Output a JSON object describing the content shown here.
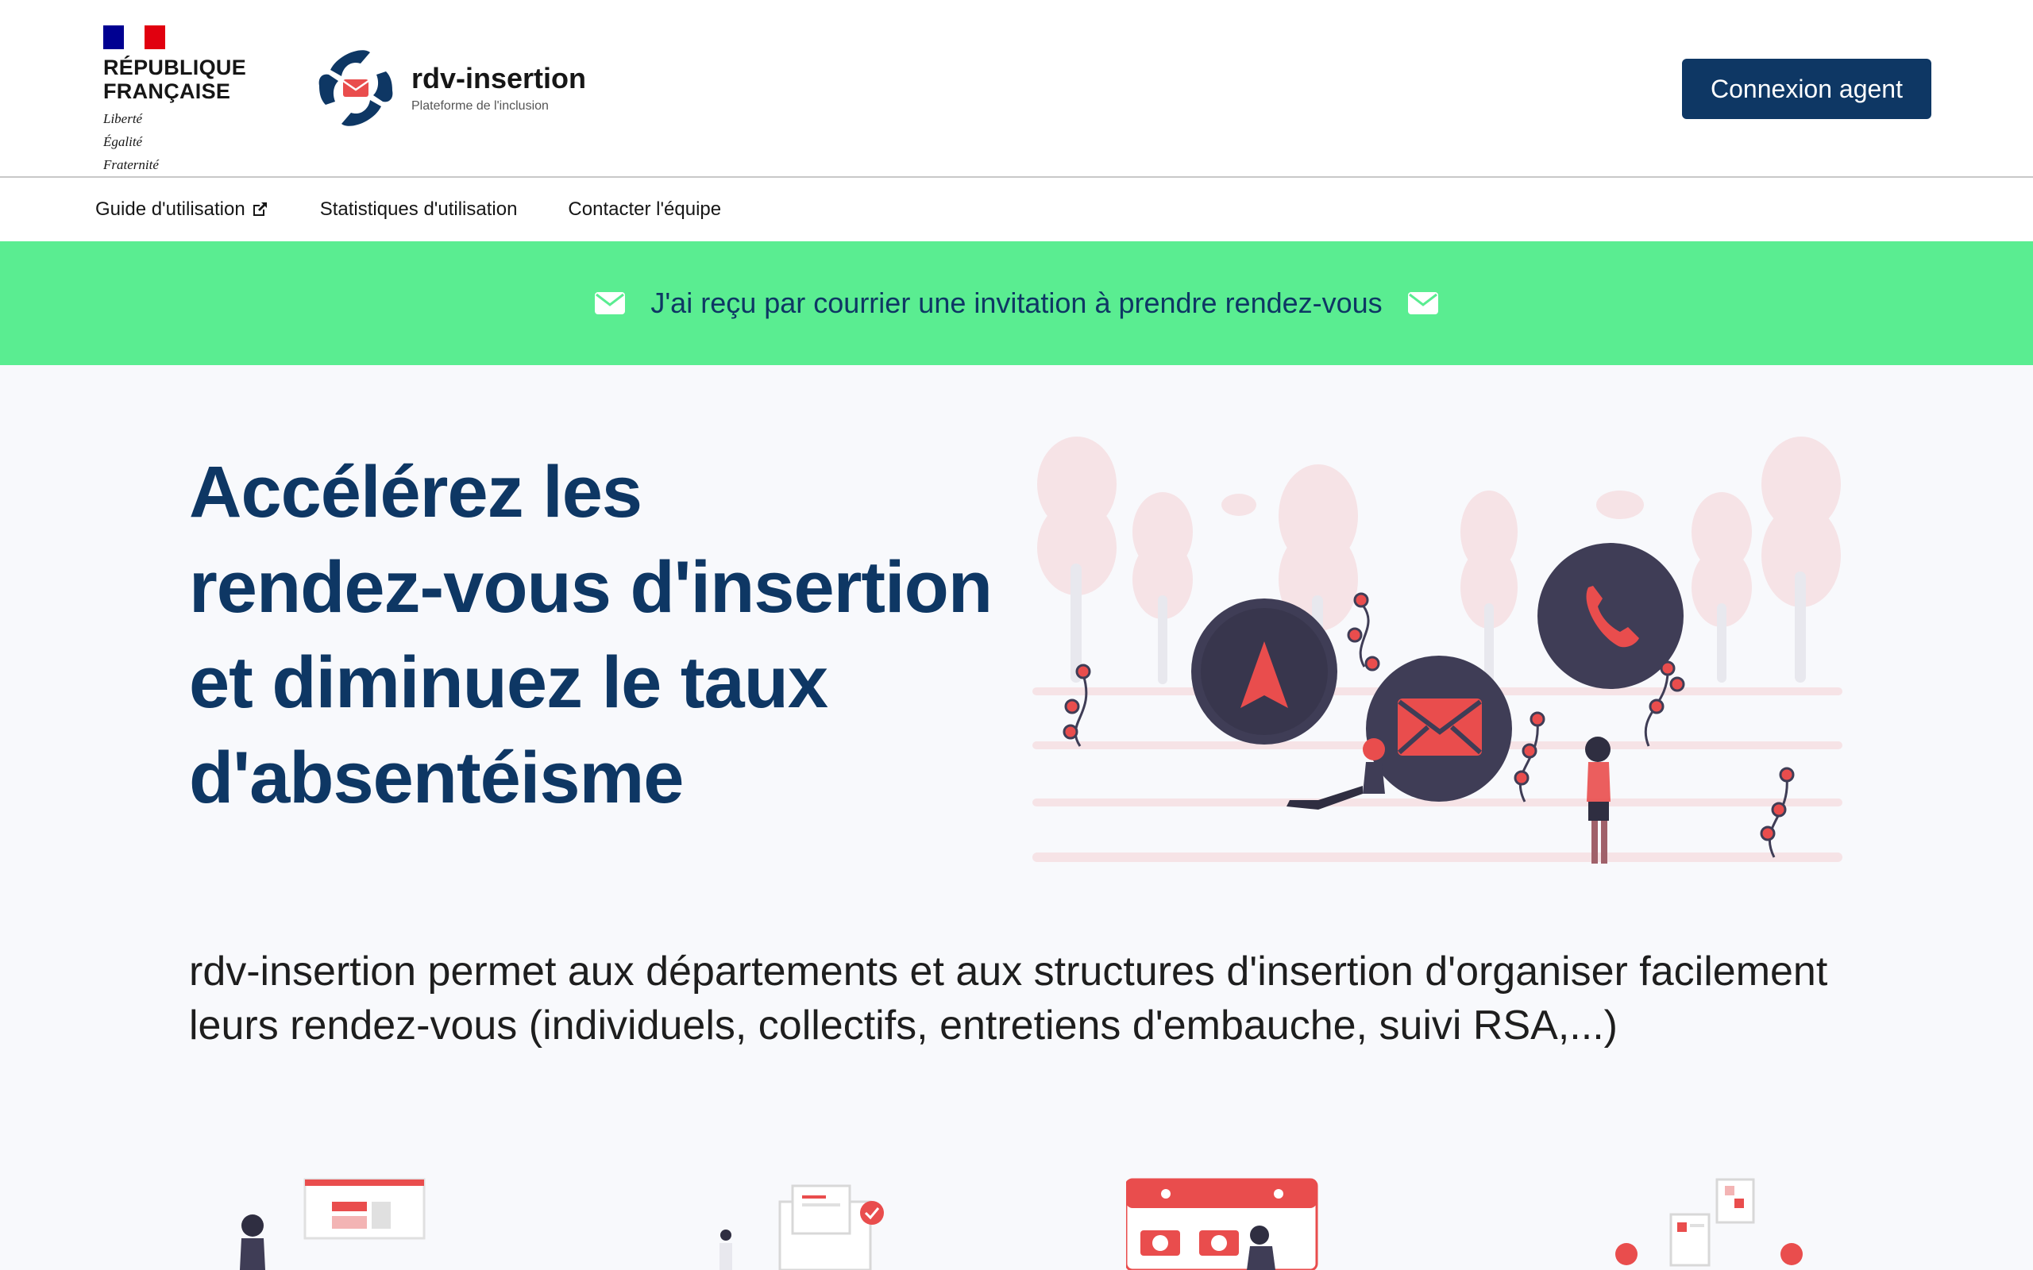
{
  "header": {
    "republic": {
      "line1": "RÉPUBLIQUE",
      "line2": "FRANÇAISE",
      "motto1": "Liberté",
      "motto2": "Égalité",
      "motto3": "Fraternité",
      "flag_colors": [
        "#000091",
        "#ffffff",
        "#e1000f"
      ]
    },
    "brand": {
      "name": "rdv-insertion",
      "tagline": "Plateforme de l'inclusion"
    },
    "agent_button": "Connexion agent"
  },
  "nav": {
    "items": [
      {
        "label": "Guide d'utilisation",
        "icon": "external-link-icon"
      },
      {
        "label": "Statistiques d'utilisation"
      },
      {
        "label": "Contacter l'équipe"
      }
    ]
  },
  "banner": {
    "text": "J'ai reçu par courrier une invitation à prendre rendez-vous",
    "icon": "envelope-icon"
  },
  "hero": {
    "title_line1": "Accélérez les",
    "title_line2": "rendez-vous d'insertion",
    "title_line3": "et diminuez le taux",
    "title_line4": "d'absentéisme"
  },
  "intro": {
    "text": "rdv-insertion permet aux départements et aux structures d'insertion d'organiser facilement leurs rendez-vous (individuels, collectifs, entretiens d'embauche, suivi RSA,...)"
  },
  "colors": {
    "primary": "#0e3764",
    "banner": "#5aed91",
    "accent_red": "#e94d4d",
    "dark_circle": "#3f3d56"
  }
}
